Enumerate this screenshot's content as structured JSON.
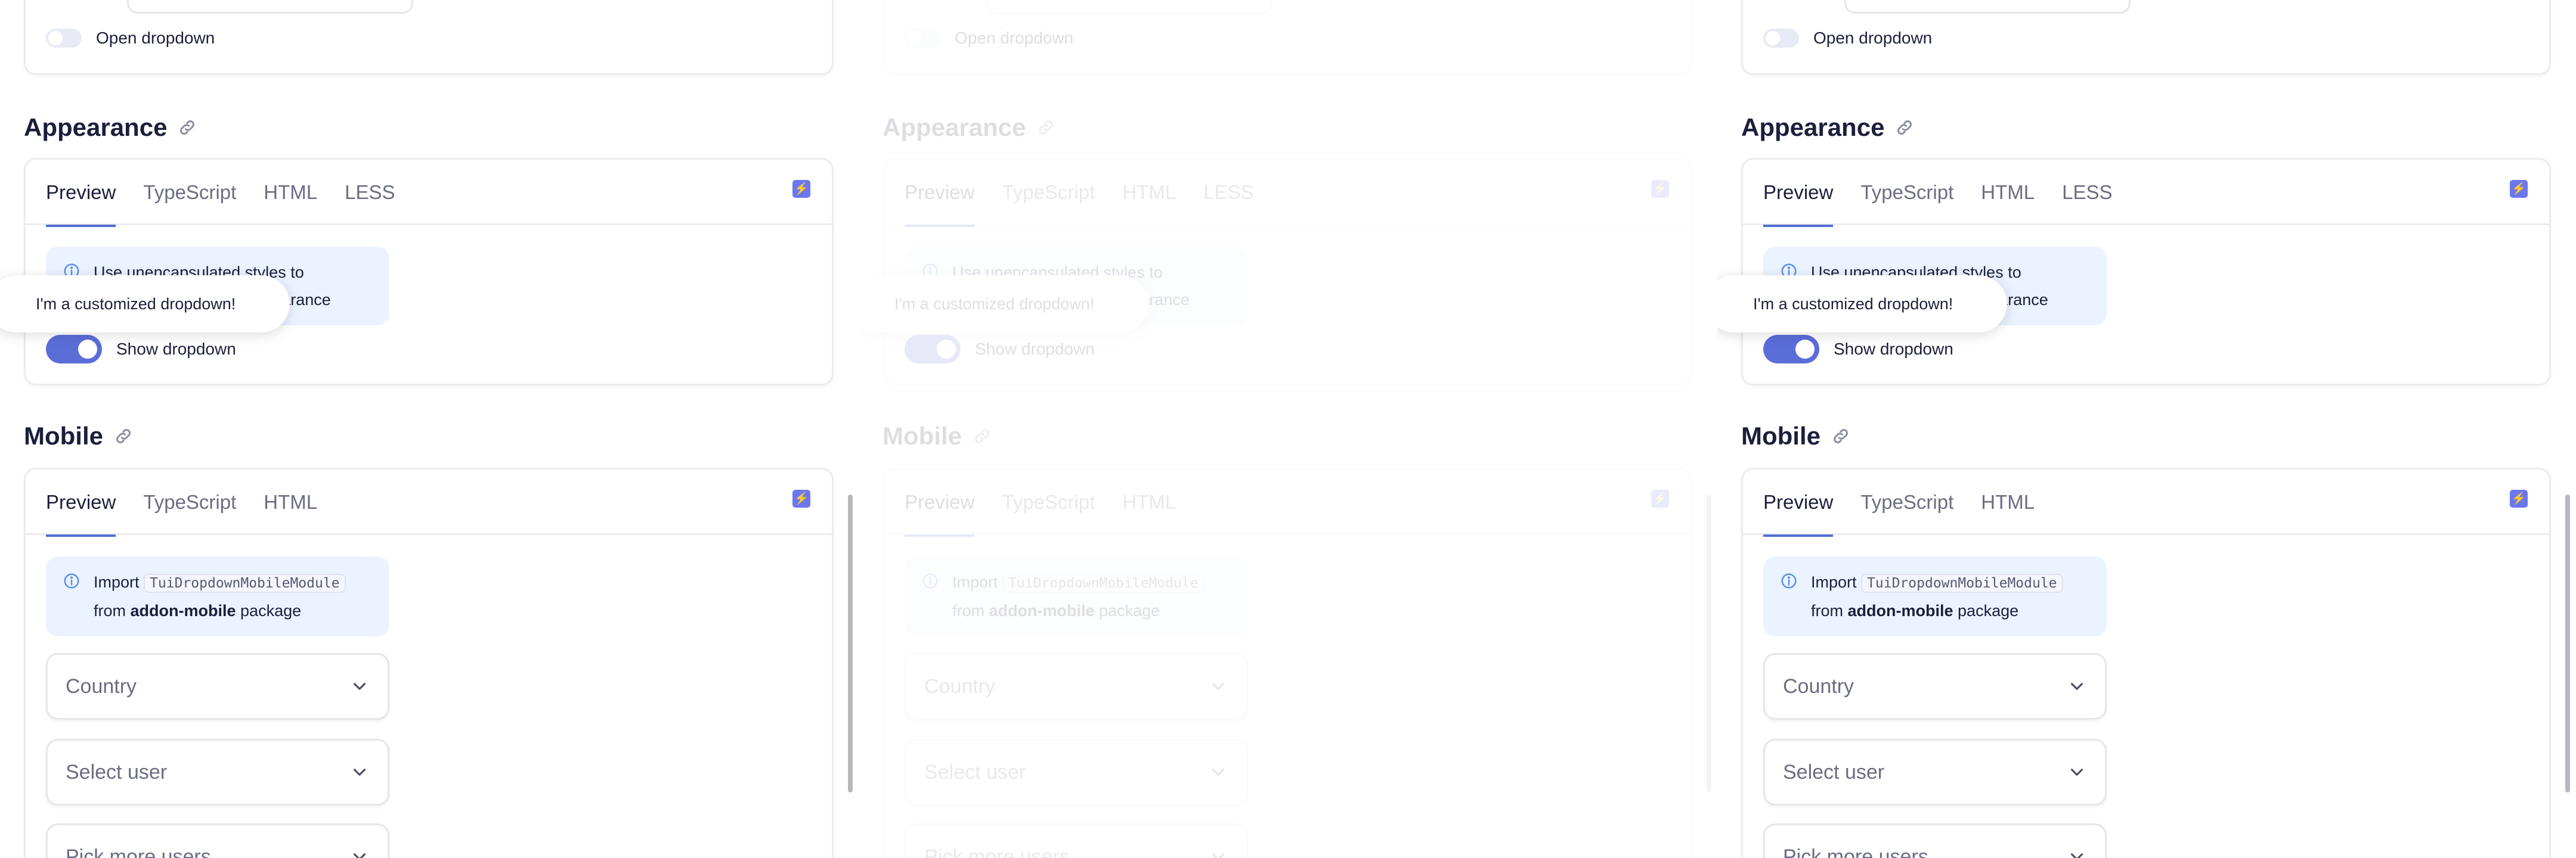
{
  "panels": [
    {
      "top_toggle_label": "Open dropdown",
      "appearance": {
        "heading": "Appearance",
        "tabs": [
          "Preview",
          "TypeScript",
          "HTML",
          "LESS"
        ],
        "notice": "Use unencapsulated styles to customize dropdown appearance",
        "tooltip": "I'm a customized dropdown!",
        "toggle_label": "Show dropdown"
      },
      "mobile": {
        "heading": "Mobile",
        "tabs": [
          "Preview",
          "TypeScript",
          "HTML"
        ],
        "notice_prefix": "Import",
        "notice_code": "TuiDropdownMobileModule",
        "notice_from": "from",
        "notice_pkg": "addon-mobile",
        "notice_suffix": "package",
        "selects": [
          "Country",
          "Select user",
          "Pick more users"
        ]
      }
    },
    {
      "top_toggle_label": "Open dropdown",
      "appearance": {
        "heading": "Appearance",
        "tabs": [
          "Preview",
          "TypeScript",
          "HTML",
          "LESS"
        ],
        "notice": "Use unencapsulated styles to customize dropdown appearance",
        "tooltip": "I'm a customized dropdown!",
        "toggle_label": "Show dropdown"
      },
      "mobile": {
        "heading": "Mobile",
        "tabs": [
          "Preview",
          "TypeScript",
          "HTML"
        ],
        "notice_prefix": "Import",
        "notice_code": "TuiDropdownMobileModule",
        "notice_from": "from",
        "notice_pkg": "addon-mobile",
        "notice_suffix": "package",
        "selects": [
          "Country",
          "Select user",
          "Pick more users"
        ]
      }
    },
    {
      "top_toggle_label": "Open dropdown",
      "appearance": {
        "heading": "Appearance",
        "tabs": [
          "Preview",
          "TypeScript",
          "HTML",
          "LESS"
        ],
        "notice": "Use unencapsulated styles to customize dropdown appearance",
        "tooltip": "I'm a customized dropdown!",
        "toggle_label": "Show dropdown"
      },
      "mobile": {
        "heading": "Mobile",
        "tabs": [
          "Preview",
          "TypeScript",
          "HTML"
        ],
        "notice_prefix": "Import",
        "notice_code": "TuiDropdownMobileModule",
        "notice_from": "from",
        "notice_pkg": "addon-mobile",
        "notice_suffix": "package",
        "selects": [
          "Country",
          "Select user",
          "Pick more users"
        ]
      }
    }
  ],
  "icons": {
    "link": "link-icon",
    "info": "info-icon",
    "chevron": "chevron-down-icon",
    "stackblitz": "stackblitz-icon"
  },
  "colors": {
    "accent": "#526ed3",
    "toggle_on": "#5b6dd8",
    "notice_bg": "#eaf3ff",
    "text": "#1b1f3b",
    "muted": "#6a6d82"
  }
}
